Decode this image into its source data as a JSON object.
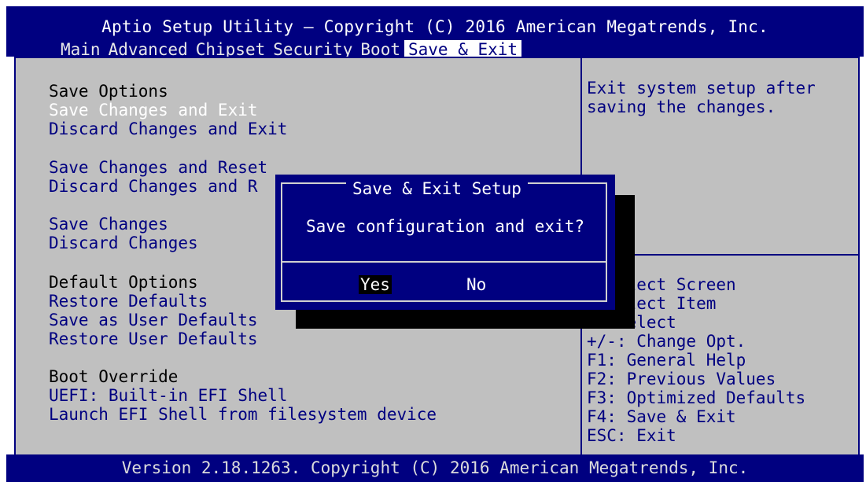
{
  "header": {
    "title": "Aptio Setup Utility – Copyright (C) 2016 American Megatrends, Inc.",
    "tabs": [
      "Main",
      "Advanced",
      "Chipset",
      "Security",
      "Boot",
      "Save & Exit"
    ],
    "active_tab": "Save & Exit"
  },
  "menu": {
    "save_options": "Save Options",
    "save_changes_and_exit": "Save Changes and Exit",
    "discard_changes_and_exit": "Discard Changes and Exit",
    "save_changes_and_reset": "Save Changes and Reset",
    "discard_changes_and_reset": "Discard Changes and R",
    "save_changes": "Save Changes",
    "discard_changes": "Discard Changes",
    "default_options": "Default Options",
    "restore_defaults": "Restore Defaults",
    "save_as_user_defaults": "Save as User Defaults",
    "restore_user_defaults": "Restore User Defaults",
    "boot_override": "Boot Override",
    "uefi_shell": "UEFI: Built-in EFI Shell",
    "launch_efi_shell": "Launch EFI Shell from filesystem device"
  },
  "help": {
    "line1": "Exit system setup after",
    "line2": "saving the changes."
  },
  "keys": {
    "select_screen": "  Select Screen",
    "select_item": "  Select Item",
    "enter_select": "r: Select",
    "change_opt": "+/-: Change Opt.",
    "general_help": "F1: General Help",
    "previous_values": "F2: Previous Values",
    "optimized_defaults": "F3: Optimized Defaults",
    "save_exit": "F4: Save & Exit",
    "esc_exit": "ESC: Exit"
  },
  "dialog": {
    "title": "Save & Exit Setup",
    "message": "Save configuration and exit?",
    "yes": "Yes",
    "no": "No"
  },
  "footer": {
    "version": "Version 2.18.1263. Copyright (C) 2016 American Megatrends, Inc."
  },
  "colors": {
    "header_bg": "#000080",
    "panel_bg": "#c0c0c0",
    "selected_text": "#ffffff"
  }
}
